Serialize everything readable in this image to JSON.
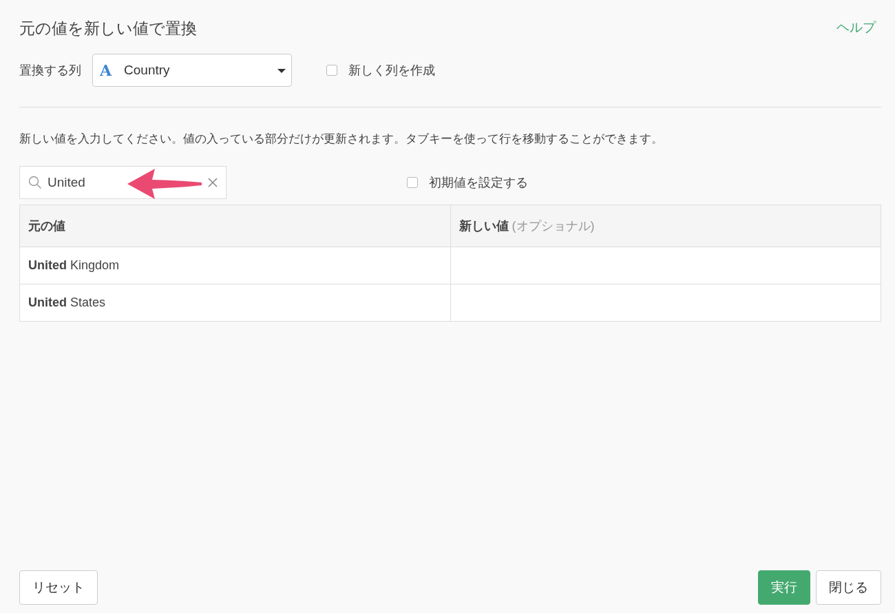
{
  "dialog": {
    "title": "元の値を新しい値で置換",
    "help_link": "ヘルプ"
  },
  "column_picker": {
    "label": "置換する列",
    "type_icon": "A",
    "value": "Country"
  },
  "create_new_column": {
    "label": "新しく列を作成",
    "checked": false
  },
  "instructions": "新しい値を入力してください。値の入っている部分だけが更新されます。タブキーを使って行を移動することができます。",
  "search": {
    "value": "United"
  },
  "set_default": {
    "label": "初期値を設定する",
    "checked": false
  },
  "table": {
    "columns": [
      {
        "label": "元の値"
      },
      {
        "label": "新しい値",
        "note": "(オプショナル)"
      }
    ],
    "rows": [
      {
        "original": "**United** Kingdom"
      },
      {
        "original": "**United** States"
      }
    ]
  },
  "buttons": [
    {
      "label": "リセット",
      "kind": "default"
    },
    {
      "label": "実行",
      "kind": "primary"
    },
    {
      "label": "閉じる",
      "kind": "default"
    }
  ]
}
